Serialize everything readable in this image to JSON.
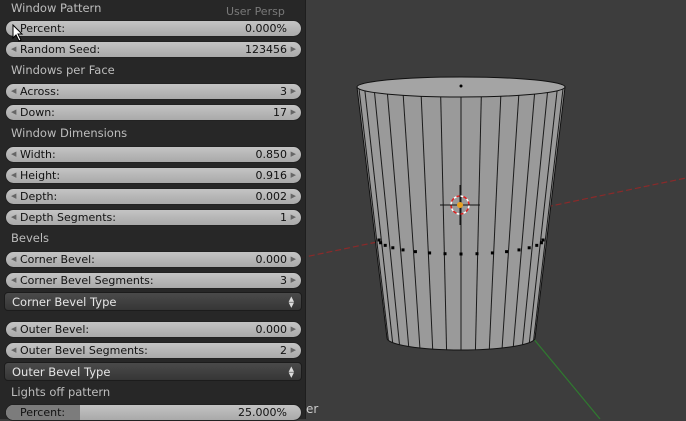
{
  "viewport": {
    "label": "User Persp",
    "partial_label": "er"
  },
  "sections": [
    {
      "title": "Window Pattern",
      "fields": [
        {
          "label": "Percent:",
          "value": "0.000%",
          "kind": "slider",
          "fraction": 0.0
        },
        {
          "label": "Random Seed:",
          "value": "123456",
          "kind": "number"
        }
      ]
    },
    {
      "title": "Windows per Face",
      "fields": [
        {
          "label": "Across:",
          "value": "3",
          "kind": "number"
        },
        {
          "label": "Down:",
          "value": "17",
          "kind": "number"
        }
      ]
    },
    {
      "title": "Window Dimensions",
      "fields": [
        {
          "label": "Width:",
          "value": "0.850",
          "kind": "number"
        },
        {
          "label": "Height:",
          "value": "0.916",
          "kind": "number"
        },
        {
          "label": "Depth:",
          "value": "0.002",
          "kind": "number"
        },
        {
          "label": "Depth Segments:",
          "value": "1",
          "kind": "number"
        }
      ]
    },
    {
      "title": "Bevels",
      "fields": [
        {
          "label": "Corner Bevel:",
          "value": "0.000",
          "kind": "number"
        },
        {
          "label": "Corner Bevel Segments:",
          "value": "3",
          "kind": "number"
        },
        {
          "label": "Corner Bevel Type",
          "kind": "dropdown"
        },
        {
          "label": "Outer Bevel:",
          "value": "0.000",
          "kind": "number"
        },
        {
          "label": "Outer Bevel Segments:",
          "value": "2",
          "kind": "number"
        },
        {
          "label": "Outer Bevel Type",
          "kind": "dropdown"
        }
      ]
    },
    {
      "title": "Lights off pattern",
      "fields": [
        {
          "label": "Percent:",
          "value": "25.000%",
          "kind": "slider",
          "fraction": 0.25
        }
      ]
    }
  ]
}
